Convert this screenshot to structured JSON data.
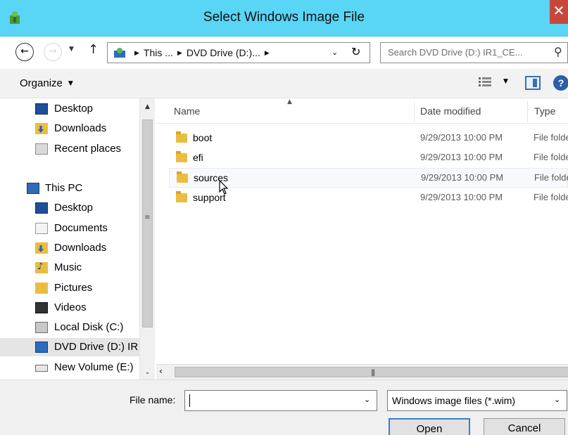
{
  "window": {
    "title": "Select Windows Image File",
    "close_glyph": "✕"
  },
  "address": {
    "crumb1": "This ...",
    "crumb2": "DVD Drive (D:)...",
    "search_placeholder": "Search DVD Drive (D:) IR1_CE..."
  },
  "toolbar": {
    "organize_label": "Organize"
  },
  "nav": {
    "items": [
      {
        "label": "Desktop",
        "icon": "desktop-icon"
      },
      {
        "label": "Downloads",
        "icon": "downloads-icon"
      },
      {
        "label": "Recent places",
        "icon": "recent-places-icon"
      },
      {
        "label": "This PC",
        "icon": "this-pc-icon"
      },
      {
        "label": "Desktop",
        "icon": "desktop-icon"
      },
      {
        "label": "Documents",
        "icon": "documents-icon"
      },
      {
        "label": "Downloads",
        "icon": "downloads-icon"
      },
      {
        "label": "Music",
        "icon": "music-icon"
      },
      {
        "label": "Pictures",
        "icon": "pictures-icon"
      },
      {
        "label": "Videos",
        "icon": "videos-icon"
      },
      {
        "label": "Local Disk (C:)",
        "icon": "local-disk-icon"
      },
      {
        "label": "DVD Drive (D:) IR",
        "icon": "dvd-drive-icon"
      },
      {
        "label": "New Volume (E:)",
        "icon": "new-volume-icon"
      }
    ]
  },
  "files": {
    "columns": {
      "name": "Name",
      "date": "Date modified",
      "type": "Type"
    },
    "rows": [
      {
        "name": "boot",
        "date": "9/29/2013 10:00 PM",
        "type": "File folder"
      },
      {
        "name": "efi",
        "date": "9/29/2013 10:00 PM",
        "type": "File folder"
      },
      {
        "name": "sources",
        "date": "9/29/2013 10:00 PM",
        "type": "File folder"
      },
      {
        "name": "support",
        "date": "9/29/2013 10:00 PM",
        "type": "File folder"
      }
    ]
  },
  "bottom": {
    "file_name_label": "File name:",
    "file_name_value": "",
    "filter_value": "Windows image files (*.wim)",
    "open_label": "Open",
    "cancel_label": "Cancel"
  },
  "colors": {
    "titlebar": "#59d5f5",
    "close": "#c7483b",
    "folder": "#e9bd3f",
    "accent": "#3a7bd5"
  }
}
